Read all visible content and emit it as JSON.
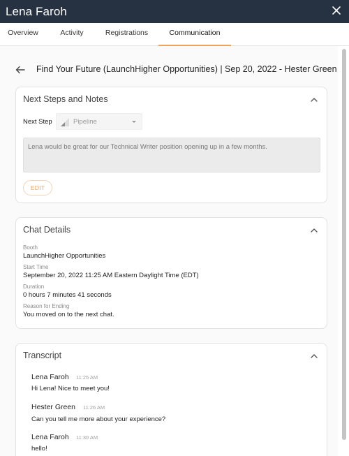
{
  "header": {
    "title": "Lena Faroh",
    "close_icon": "close-icon"
  },
  "tabs": [
    {
      "label": "Overview",
      "active": false
    },
    {
      "label": "Activity",
      "active": false
    },
    {
      "label": "Registrations",
      "active": false
    },
    {
      "label": "Communication",
      "active": true
    }
  ],
  "page": {
    "title": "Find Your Future (LaunchHigher Opportunities) | Sep 20, 2022 - Hester Green",
    "back_icon": "back-arrow-icon"
  },
  "next_steps": {
    "title": "Next Steps and Notes",
    "next_step_label": "Next Step",
    "next_step_value": "Pipeline",
    "note": "Lena would be great for our Technical Writer position opening up in a few months.",
    "edit_label": "EDIT"
  },
  "chat_details": {
    "title": "Chat Details",
    "fields": [
      {
        "label": "Booth",
        "value": "LaunchHigher Opportunities"
      },
      {
        "label": "Start Time",
        "value": "September 20, 2022 11:25 AM Eastern Daylight Time (EDT)"
      },
      {
        "label": "Duration",
        "value": "0 hours 7 minutes 41 seconds"
      },
      {
        "label": "Reason for Ending",
        "value": "You moved on to the next chat."
      }
    ]
  },
  "transcript": {
    "title": "Transcript",
    "messages": [
      {
        "name": "Lena Faroh",
        "time": "11:25 AM",
        "text": "Hi Lena! Nice to meet you!"
      },
      {
        "name": "Hester Green",
        "time": "11:26 AM",
        "text": "Can you tell me more about your experience?"
      },
      {
        "name": "Lena Faroh",
        "time": "11:30 AM",
        "text": "hello!"
      }
    ]
  },
  "colors": {
    "header_bg": "#263142",
    "accent": "#f0a25a"
  }
}
